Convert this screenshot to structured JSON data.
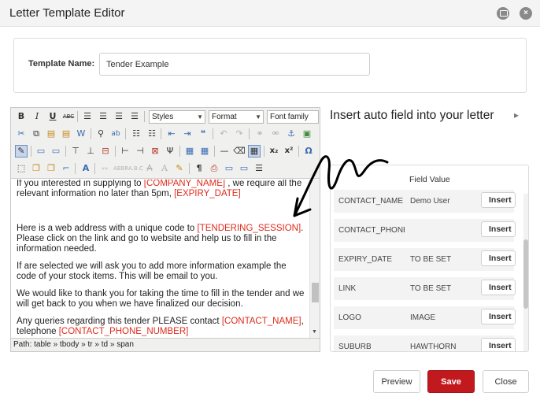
{
  "window": {
    "title": "Letter Template Editor",
    "close_glyph": "×"
  },
  "template_name": {
    "label": "Template Name:",
    "value": "Tender Example"
  },
  "editor": {
    "toolbar": {
      "styles_select": "Styles",
      "format_select": "Format",
      "font_family_select": "Font family",
      "icons": [
        "bold-icon",
        "italic-icon",
        "underline-icon",
        "strikethrough-icon",
        "align-left-icon",
        "align-center-icon",
        "align-right-icon",
        "align-justify-icon",
        "cut-icon",
        "copy-icon",
        "paste-icon",
        "paste-text-icon",
        "paste-word-icon",
        "find-icon",
        "replace-icon",
        "bullet-list-icon",
        "numbered-list-icon",
        "outdent-icon",
        "indent-icon",
        "blockquote-icon",
        "undo-icon",
        "redo-icon",
        "link-icon",
        "unlink-icon",
        "anchor-icon",
        "image-icon",
        "html-source-icon",
        "table-icon",
        "horizontal-rule-icon",
        "remove-format-icon",
        "subscript-icon",
        "superscript-icon",
        "special-char-icon",
        "show-blocks-icon",
        "spellcheck-icon",
        "print-icon",
        "pilcrow-icon"
      ]
    },
    "content": {
      "p1_before": "If you interested in supplying to ",
      "p1_field1": "[COMPANY_NAME]",
      "p1_middle": " , we require all the relevant information no later than 5pm, ",
      "p1_field2": "[EXPIRY_DATE]",
      "p2_before": "Here is a web address with a unique code to ",
      "p2_field": "[TENDERING_SESSION]",
      "p2_after": ". Please click on the link and go to website and help us to fill in the information needed.",
      "p3": "If are selected we will ask you to add more information example the code of your stock items. This will be email to you.",
      "p4": "We would like to thank you for taking the time to fill in the tender and we will get back to you when we have finalized our decision.",
      "p5_before": "Any queries regarding this tender PLEASE contact ",
      "p5_field1": "[CONTACT_NAME]",
      "p5_middle": ", telephone ",
      "p5_field2": "[CONTACT_PHONE_NUMBER]"
    },
    "path": "Path: table » tbody » tr » td » span"
  },
  "auto_fields": {
    "title": "Insert auto field into your letter",
    "expand_glyph": "▸",
    "header_value": "Field Value",
    "rows": [
      {
        "name": "CONTACT_NAME",
        "value": "Demo User",
        "button": "Insert"
      },
      {
        "name": "CONTACT_PHONE_NUMBER",
        "value": "",
        "button": "Insert"
      },
      {
        "name": "EXPIRY_DATE",
        "value": "TO BE SET",
        "button": "Insert"
      },
      {
        "name": "LINK",
        "value": "TO BE SET",
        "button": "Insert"
      },
      {
        "name": "LOGO",
        "value": "IMAGE",
        "button": "Insert"
      },
      {
        "name": "SUBURB",
        "value": "HAWTHORN",
        "button": "Insert"
      }
    ]
  },
  "footer": {
    "preview": "Preview",
    "save": "Save",
    "close": "Close"
  },
  "colors": {
    "field_token": "#e02a1b",
    "save_button": "#c2191e",
    "annotation": "#000000"
  }
}
